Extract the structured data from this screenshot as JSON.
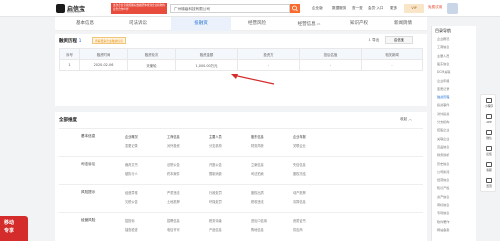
{
  "topbar": {
    "logo_text": "启信宝",
    "logo_sub": "QIXIN.COM",
    "promo_text": "这次企信宝按照图标数据帮你找到企业和你的业务合作伙伴",
    "search_value": "广州梯级科技有限公司",
    "links": [
      "企业版",
      "数据服务",
      "查一查",
      "会员·入口",
      "更多"
    ],
    "vip_label": "VIP",
    "apply_label": "免费试用"
  },
  "tabs": [
    {
      "label": "基本信息",
      "count": ""
    },
    {
      "label": "司法诉讼",
      "count": ""
    },
    {
      "label": "投融资",
      "count": ""
    },
    {
      "label": "经营风险",
      "count": ""
    },
    {
      "label": "经营信息",
      "count": "26"
    },
    {
      "label": "知识产权",
      "count": ""
    },
    {
      "label": "新闻舆情",
      "count": ""
    }
  ],
  "rounds": {
    "title": "融资历程",
    "count": "1",
    "badge": "查看更多企业融资信息",
    "export_label": "导出",
    "logo_label": "启信宝",
    "headers": [
      "序号",
      "融资时间",
      "融资轮次",
      "融资金额",
      "投资方",
      "投后估值",
      "相关新闻"
    ],
    "rows": [
      [
        "1",
        "2020-02-06",
        "天使轮",
        "1,000.00万元",
        "-",
        "-",
        "-"
      ]
    ]
  },
  "dimensions": {
    "title": "全部维度",
    "collapse_label": "收起",
    "groups": [
      {
        "name": "基本信息",
        "items": [
          "企业概况",
          "工商信息",
          "主要人员",
          "股东信息",
          "企业年报",
          "变更记录",
          "对外投资",
          "分支机构",
          "财务简析",
          "关联企业"
        ]
      },
      {
        "name": "司法诉讼",
        "items": [
          "裁判文书",
          "法院公告",
          "开庭公告",
          "立案信息",
          "失信信息",
          "被执行人",
          "终本案件",
          "限制消费",
          "司法拍卖",
          "股权冻结"
        ]
      },
      {
        "name": "风险提示",
        "items": [
          "经营异常",
          "严重违法",
          "行政处罚",
          "股权出质",
          "动产抵押",
          "欠税公告",
          "土地抵押",
          "环保处罚",
          "税收违法",
          "清算信息"
        ]
      },
      {
        "name": "经营风险",
        "items": [
          "招投标",
          "招聘信息",
          "税务评级",
          "进出口信用",
          "资质证书",
          "抽查检查",
          "电信许可",
          "产品信息",
          "购地信息",
          "供应商"
        ]
      }
    ]
  },
  "sidebar": {
    "title": "目录导航",
    "items": [
      "企业概况",
      "工商信息",
      "主要人员",
      "股东信息",
      "DCM关联",
      "企业年报",
      "变更记录",
      "融资历程",
      "投资事件",
      "对外投资",
      "分支机构",
      "控股企业",
      "关联企业",
      "竞品信息",
      "财务简析",
      "历史信息",
      "公司新闻",
      "经营信息",
      "知识产权",
      "资产信息",
      "商标信息",
      "专利信息",
      "软件著作",
      "网站备案"
    ],
    "active_index": 7
  },
  "rightbar": [
    "小程序",
    "APP",
    "微信",
    "反馈",
    "客服",
    "置顶"
  ],
  "corner": {
    "line1": "移动",
    "line2": "专享"
  },
  "colors": {
    "accent": "#1e6fd6",
    "orange": "#fb6b2d",
    "red": "#d42b2b"
  }
}
